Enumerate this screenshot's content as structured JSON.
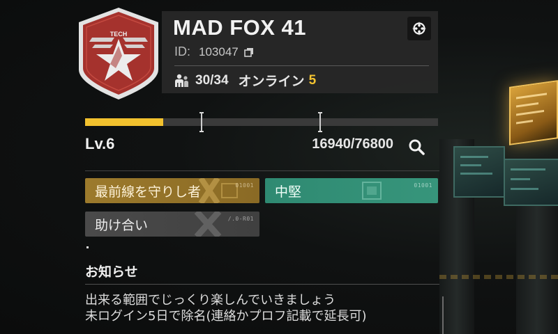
{
  "team": {
    "name": "MAD FOX 41",
    "emblem_text": "TECH",
    "id_label": "ID:",
    "id_value": "103047",
    "members": "30/34",
    "online_label": "オンライン",
    "online_count": "5"
  },
  "level": {
    "label": "Lv.6",
    "xp": "16940/76800",
    "progress": 0.2206
  },
  "tags": [
    {
      "label": "最前線を守りし者",
      "code": "01001",
      "color": "#9c7a2c"
    },
    {
      "label": "中堅",
      "code": "01001",
      "color": "#37957b"
    },
    {
      "label": "助け合い",
      "code": "/.0-R01",
      "color": "#4a4a4a"
    }
  ],
  "notice": {
    "heading": "お知らせ",
    "lines": [
      "出来る範囲でじっくり楽しんでいきましょう",
      "未ログイン5日で除名(連絡かプロフ記載で延長可)"
    ]
  },
  "icons": {
    "settings": "settings-icon",
    "copy": "copy-icon",
    "members": "members-icon",
    "search": "search-icon"
  },
  "colors": {
    "accent": "#f2c12e",
    "emblem": "#a5322d"
  }
}
